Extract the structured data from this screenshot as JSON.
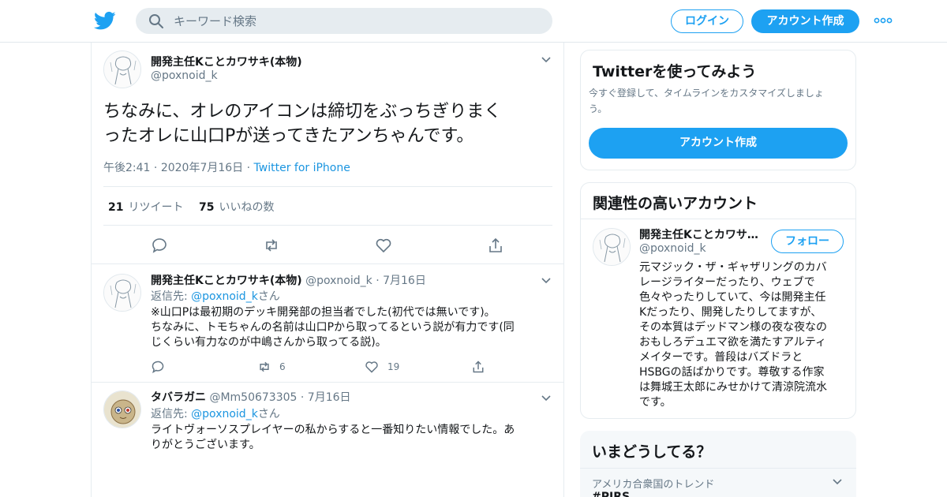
{
  "header": {
    "search_placeholder": "キーワード検索",
    "login_label": "ログイン",
    "signup_label": "アカウント作成",
    "brand_color": "#1da1f2"
  },
  "focus_tweet": {
    "author_name": "開発主任Kことカワサキ(本物)",
    "author_handle": "@poxnoid_k",
    "text_line1": "ちなみに、オレのアイコンは締切をぶっちぎりまく",
    "text_line2": "ったオレに山口Pが送ってきたアンちゃんです。",
    "time": "午後2:41",
    "date": "2020年7月16日",
    "source": "Twitter for iPhone",
    "retweets_count": "21",
    "retweets_label": "リツイート",
    "likes_count": "75",
    "likes_label": "いいねの数"
  },
  "replies": [
    {
      "author_name": "開発主任Kことカワサキ(本物)",
      "author_handle": "@poxnoid_k",
      "date": "7月16日",
      "replyto_prefix": "返信先: ",
      "replyto_handle": "@poxnoid_k",
      "replyto_suffix": "さん",
      "line1": "※山口Pは最初期のデッキ開発部の担当者でした(初代では無いです)。",
      "line2": "ちなみに、トモちゃんの名前は山口Pから取ってるという説が有力です(同",
      "line3": "じくらい有力なのが中嶋さんから取ってる説)。",
      "retweets": "6",
      "likes": "19"
    },
    {
      "author_name": "タバラガニ",
      "author_handle": "@Mm50673305",
      "date": "7月16日",
      "replyto_prefix": "返信先: ",
      "replyto_handle": "@poxnoid_k",
      "replyto_suffix": "さん",
      "line1": "ライトヴォーソスプレイヤーの私からすると一番知りたい情報でした。あ",
      "line2": "りがとうございます。"
    }
  ],
  "sidebar": {
    "try_title": "Twitterを使ってみよう",
    "try_sub_line1": "今すぐ登録して、タイムラインをカスタマイズしましょ",
    "try_sub_line2": "う。",
    "try_button": "アカウント作成",
    "related_title": "関連性の高いアカウント",
    "related_name": "開発主任Kことカワサ…",
    "related_handle": "@poxnoid_k",
    "follow_label": "フォロー",
    "bio_lines": [
      "元マジック・ザ・ギャザリングのカバ",
      "レージライターだったり、ウェブで",
      "色々やったりしていて、今は開発主任",
      "Kだったり、開発したりしてますが、",
      "その本質はデッドマン様の夜な夜なの",
      "おもしろデュエマ欲を満たすアルティ",
      "メイターです。普段はバズドラと",
      "HSBGの話ばかりです。尊敬する作家",
      "は舞城王太郎にみせかけて清涼院流水",
      "です。"
    ],
    "trends_title": "いまどうしてる？",
    "trends_region": "アメリカ合衆国のトレンド",
    "trend_first": "#PIRS"
  }
}
